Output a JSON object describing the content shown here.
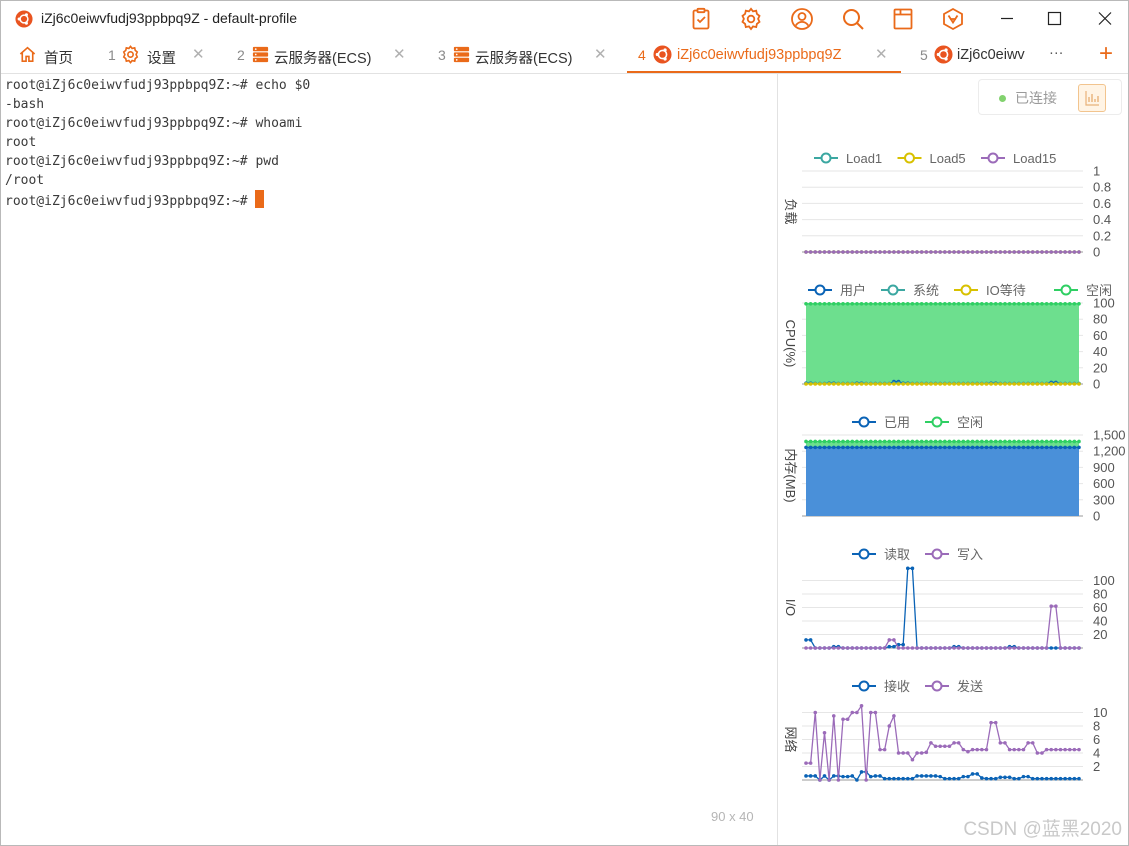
{
  "window": {
    "title": "iZj6c0eiwvfudj93ppbpq9Z - default-profile"
  },
  "toolbar": {
    "icons": [
      "clipboard-icon",
      "gear-icon",
      "user-icon",
      "search-icon",
      "layout-icon",
      "logo-icon"
    ]
  },
  "tabs": [
    {
      "num": "",
      "label": "首页",
      "icon": "home-icon"
    },
    {
      "num": "1",
      "label": "设置",
      "icon": "gear-icon"
    },
    {
      "num": "2",
      "label": "云服务器(ECS)",
      "icon": "server-icon"
    },
    {
      "num": "3",
      "label": "云服务器(ECS)",
      "icon": "server-icon"
    },
    {
      "num": "4",
      "label": "iZj6c0eiwvfudj93ppbpq9Z",
      "icon": "ubuntu-icon",
      "active": true
    },
    {
      "num": "5",
      "label": "iZj6c0eiwv",
      "icon": "ubuntu-icon"
    }
  ],
  "tab_more": "···",
  "tab_add": "+",
  "terminal": {
    "lines": [
      "root@iZj6c0eiwvfudj93ppbpq9Z:~# echo $0",
      "-bash",
      "root@iZj6c0eiwvfudj93ppbpq9Z:~# whoami",
      "root",
      "root@iZj6c0eiwvfudj93ppbpq9Z:~# pwd",
      "/root",
      "root@iZj6c0eiwvfudj93ppbpq9Z:~# "
    ],
    "size": "90 x 40"
  },
  "status": {
    "connected": "已连接"
  },
  "colors": {
    "accent": "#ea6a19",
    "blue": "#0a63b6",
    "teal": "#3ba7a1",
    "yellow": "#d8c100",
    "purple": "#9b6bb9",
    "green": "#2fcf63",
    "memfill": "#4a90d9",
    "cpufill": "#6ddf8e"
  },
  "watermark": "CSDN @蓝黑2020",
  "chart_data": [
    {
      "type": "line",
      "ylabel": "负载",
      "yticks": [
        "1",
        "0.8",
        "0.6",
        "0.4",
        "0.2",
        "0"
      ],
      "ylim": [
        0,
        1
      ],
      "series": [
        {
          "name": "Load1",
          "color": "#3ba7a1",
          "values": [
            0,
            0,
            0,
            0,
            0,
            0,
            0,
            0,
            0,
            0,
            0,
            0,
            0,
            0,
            0,
            0,
            0,
            0,
            0,
            0,
            0,
            0,
            0,
            0,
            0,
            0,
            0,
            0,
            0,
            0,
            0,
            0,
            0,
            0,
            0,
            0,
            0,
            0,
            0,
            0,
            0,
            0,
            0,
            0,
            0,
            0,
            0,
            0,
            0,
            0,
            0,
            0,
            0,
            0,
            0,
            0,
            0,
            0,
            0,
            0
          ]
        },
        {
          "name": "Load5",
          "color": "#d8c100",
          "values": [
            0,
            0,
            0,
            0,
            0,
            0,
            0,
            0,
            0,
            0,
            0,
            0,
            0,
            0,
            0,
            0,
            0,
            0,
            0,
            0,
            0,
            0,
            0,
            0,
            0,
            0,
            0,
            0,
            0,
            0,
            0,
            0,
            0,
            0,
            0,
            0,
            0,
            0,
            0,
            0,
            0,
            0,
            0,
            0,
            0,
            0,
            0,
            0,
            0,
            0,
            0,
            0,
            0,
            0,
            0,
            0,
            0,
            0,
            0,
            0
          ]
        },
        {
          "name": "Load15",
          "color": "#9b6bb9",
          "values": [
            0,
            0,
            0,
            0,
            0,
            0,
            0,
            0,
            0,
            0,
            0,
            0,
            0,
            0,
            0,
            0,
            0,
            0,
            0,
            0,
            0,
            0,
            0,
            0,
            0,
            0,
            0,
            0,
            0,
            0,
            0,
            0,
            0,
            0,
            0,
            0,
            0,
            0,
            0,
            0,
            0,
            0,
            0,
            0,
            0,
            0,
            0,
            0,
            0,
            0,
            0,
            0,
            0,
            0,
            0,
            0,
            0,
            0,
            0,
            0
          ]
        }
      ]
    },
    {
      "type": "area",
      "ylabel": "CPU(%)",
      "yticks": [
        "100",
        "80",
        "60",
        "40",
        "20",
        "0"
      ],
      "ylim": [
        0,
        100
      ],
      "series": [
        {
          "name": "用户",
          "color": "#0a63b6",
          "values": [
            1,
            1,
            0.5,
            0.5,
            0.5,
            1,
            1,
            0.5,
            0.5,
            0.5,
            0.5,
            1,
            1,
            0.5,
            0.5,
            0.5,
            0.5,
            0.5,
            0.5,
            3,
            3,
            1,
            1,
            0.5,
            0.5,
            0.5,
            0.5,
            0.5,
            0.5,
            0.5,
            0.5,
            0.5,
            0.5,
            0.5,
            0.5,
            0.5,
            0.5,
            0.5,
            0.5,
            0.5,
            1,
            1,
            0.5,
            0.5,
            0.5,
            0.5,
            0.5,
            0.5,
            0.5,
            0.5,
            0.5,
            0.5,
            0.5,
            2,
            2,
            0.5,
            0.5,
            0.5,
            0.5,
            0.5
          ]
        },
        {
          "name": "系统",
          "color": "#3ba7a1",
          "values": [
            0.5,
            0.5,
            0.5,
            0.5,
            0.5,
            0.5,
            0.5,
            0.5,
            0.5,
            0.5,
            0.5,
            0.5,
            0.5,
            0.5,
            0.5,
            0.5,
            0.5,
            0.5,
            0.5,
            1,
            1,
            0.5,
            0.5,
            0.5,
            0.5,
            0.5,
            0.5,
            0.5,
            0.5,
            0.5,
            0.5,
            0.5,
            0.5,
            0.5,
            0.5,
            0.5,
            0.5,
            0.5,
            0.5,
            0.5,
            0.5,
            0.5,
            0.5,
            0.5,
            0.5,
            0.5,
            0.5,
            0.5,
            0.5,
            0.5,
            0.5,
            0.5,
            0.5,
            0.5,
            0.5,
            0.5,
            0.5,
            0.5,
            0.5,
            0.5
          ]
        },
        {
          "name": "IO等待",
          "color": "#d8c100",
          "values": [
            0,
            0,
            0,
            0,
            0,
            0,
            0,
            0,
            0,
            0,
            0,
            0,
            0,
            0,
            0,
            0,
            0,
            0,
            0,
            0,
            0,
            0,
            0,
            0,
            0,
            0,
            0,
            0,
            0,
            0,
            0,
            0,
            0,
            0,
            0,
            0,
            0,
            0,
            0,
            0,
            0,
            0,
            0,
            0,
            0,
            0,
            0,
            0,
            0,
            0,
            0,
            0,
            0,
            0,
            0,
            0,
            0,
            0,
            0,
            0
          ]
        },
        {
          "name": "空闲",
          "color": "#2fcf63",
          "values": [
            99,
            99,
            99,
            99,
            99,
            99,
            99,
            99,
            99,
            99,
            99,
            99,
            99,
            99,
            99,
            99,
            99,
            99,
            99,
            99,
            99,
            99,
            99,
            99,
            99,
            99,
            99,
            99,
            99,
            99,
            99,
            99,
            99,
            99,
            99,
            99,
            99,
            99,
            99,
            99,
            99,
            99,
            99,
            99,
            99,
            99,
            99,
            99,
            99,
            99,
            99,
            99,
            99,
            99,
            99,
            99,
            99,
            99,
            99,
            99
          ]
        }
      ]
    },
    {
      "type": "area",
      "ylabel": "内存(MB)",
      "yticks": [
        "1,500",
        "1,200",
        "900",
        "600",
        "300",
        "0"
      ],
      "ylim": [
        0,
        1500
      ],
      "series": [
        {
          "name": "已用",
          "color": "#0a63b6",
          "values": [
            1270,
            1270,
            1270,
            1270,
            1270,
            1270,
            1270,
            1270,
            1270,
            1270,
            1270,
            1270,
            1270,
            1270,
            1270,
            1270,
            1270,
            1270,
            1270,
            1270,
            1270,
            1270,
            1270,
            1270,
            1270,
            1270,
            1270,
            1270,
            1270,
            1270,
            1270,
            1270,
            1270,
            1270,
            1270,
            1270,
            1270,
            1270,
            1270,
            1270,
            1270,
            1270,
            1270,
            1270,
            1270,
            1270,
            1270,
            1270,
            1270,
            1270,
            1270,
            1270,
            1270,
            1270,
            1270,
            1270,
            1270,
            1270,
            1270,
            1270
          ]
        },
        {
          "name": "空闲",
          "color": "#2fcf63",
          "values": [
            1380,
            1380,
            1380,
            1380,
            1380,
            1380,
            1380,
            1380,
            1380,
            1380,
            1380,
            1380,
            1380,
            1380,
            1380,
            1380,
            1380,
            1380,
            1380,
            1380,
            1380,
            1380,
            1380,
            1380,
            1380,
            1380,
            1380,
            1380,
            1380,
            1380,
            1380,
            1380,
            1380,
            1380,
            1380,
            1380,
            1380,
            1380,
            1380,
            1380,
            1380,
            1380,
            1380,
            1380,
            1380,
            1380,
            1380,
            1380,
            1380,
            1380,
            1380,
            1380,
            1380,
            1380,
            1380,
            1380,
            1380,
            1380,
            1380,
            1380
          ]
        }
      ]
    },
    {
      "type": "line",
      "ylabel": "I/O",
      "yticks": [
        "100",
        "80",
        "60",
        "40",
        "20"
      ],
      "ylim": [
        0,
        120
      ],
      "series": [
        {
          "name": "读取",
          "color": "#0a63b6",
          "values": [
            12,
            12,
            0,
            0,
            0,
            0,
            2,
            2,
            0,
            0,
            0,
            0,
            0,
            0,
            0,
            0,
            0,
            0,
            2,
            2,
            5,
            5,
            118,
            118,
            0,
            0,
            0,
            0,
            0,
            0,
            0,
            0,
            2,
            2,
            0,
            0,
            0,
            0,
            0,
            0,
            0,
            0,
            0,
            0,
            2,
            2,
            0,
            0,
            0,
            0,
            0,
            0,
            0,
            0,
            0,
            0,
            0,
            0,
            0,
            0
          ]
        },
        {
          "name": "写入",
          "color": "#9b6bb9",
          "values": [
            0,
            0,
            0,
            0,
            0,
            0,
            0,
            0,
            0,
            0,
            0,
            0,
            0,
            0,
            0,
            0,
            0,
            0,
            12,
            12,
            0,
            0,
            0,
            0,
            0,
            0,
            0,
            0,
            0,
            0,
            0,
            0,
            0,
            0,
            0,
            0,
            0,
            0,
            0,
            0,
            0,
            0,
            0,
            0,
            0,
            0,
            0,
            0,
            0,
            0,
            0,
            0,
            0,
            62,
            62,
            0,
            0,
            0,
            0,
            0
          ]
        }
      ]
    },
    {
      "type": "line",
      "ylabel": "网络",
      "yticks": [
        "10",
        "8",
        "6",
        "4",
        "2"
      ],
      "ylim": [
        0,
        12
      ],
      "series": [
        {
          "name": "接收",
          "color": "#0a63b6",
          "values": [
            0.6,
            0.6,
            0.6,
            0,
            0.6,
            0,
            0.6,
            0.6,
            0.5,
            0.5,
            0.6,
            0,
            1.2,
            1.2,
            0.5,
            0.6,
            0.6,
            0.2,
            0.2,
            0.2,
            0.2,
            0.2,
            0.2,
            0.2,
            0.6,
            0.6,
            0.6,
            0.6,
            0.6,
            0.5,
            0.2,
            0.2,
            0.2,
            0.2,
            0.5,
            0.5,
            0.9,
            0.9,
            0.3,
            0.2,
            0.2,
            0.2,
            0.4,
            0.4,
            0.4,
            0.2,
            0.2,
            0.5,
            0.5,
            0.2,
            0.2,
            0.2,
            0.2,
            0.2,
            0.2,
            0.2,
            0.2,
            0.2,
            0.2,
            0.2
          ]
        },
        {
          "name": "发送",
          "color": "#9b6bb9",
          "values": [
            2.5,
            2.5,
            10,
            0,
            7,
            0,
            9.5,
            0,
            9,
            9,
            10,
            10,
            11,
            0,
            10,
            10,
            4.5,
            4.5,
            8,
            9.5,
            4,
            4,
            4,
            3,
            4,
            4,
            4.1,
            5.5,
            5,
            5,
            5,
            5,
            5.5,
            5.5,
            4.5,
            4.2,
            4.5,
            4.5,
            4.5,
            4.5,
            8.5,
            8.5,
            5.5,
            5.5,
            4.5,
            4.5,
            4.5,
            4.5,
            5.5,
            5.5,
            4,
            4,
            4.5,
            4.5,
            4.5,
            4.5,
            4.5,
            4.5,
            4.5,
            4.5
          ]
        }
      ]
    }
  ]
}
